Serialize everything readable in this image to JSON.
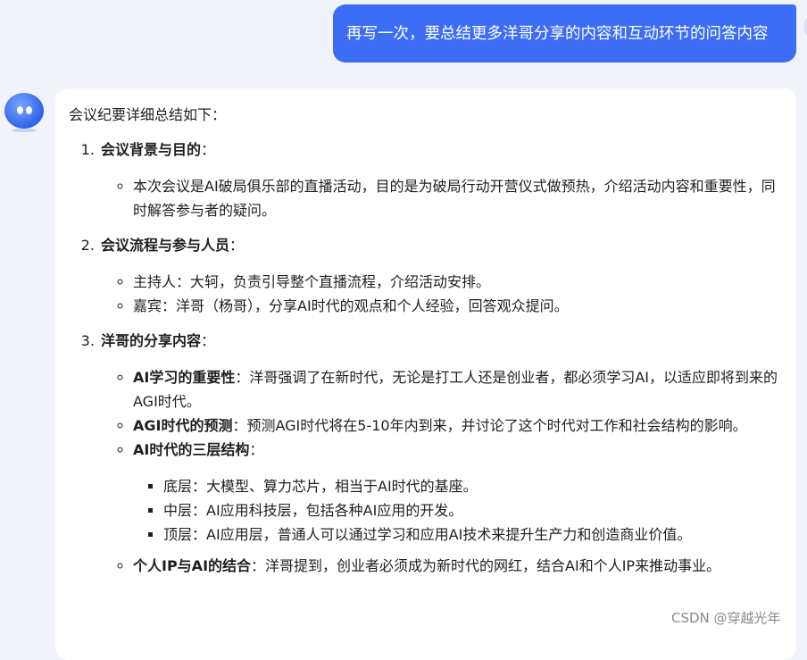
{
  "user_message": "再写一次，要总结更多洋哥分享的内容和互动环节的问答内容",
  "answer": {
    "intro": "会议纪要详细总结如下：",
    "sections": [
      {
        "number": "1.",
        "title": "会议背景与目的",
        "suffix": "：",
        "bullets": [
          {
            "text": "本次会议是AI破局俱乐部的直播活动，目的是为破局行动开营仪式做预热，介绍活动内容和重要性，同时解答参与者的疑问。"
          }
        ]
      },
      {
        "number": "2.",
        "title": "会议流程与参与人员",
        "suffix": "：",
        "bullets": [
          {
            "text": "主持人：大轲，负责引导整个直播流程，介绍活动安排。"
          },
          {
            "text": "嘉宾：洋哥（杨哥），分享AI时代的观点和个人经验，回答观众提问。"
          }
        ]
      },
      {
        "number": "3.",
        "title": "洋哥的分享内容",
        "suffix": "：",
        "bullets": [
          {
            "label": "AI学习的重要性",
            "text": "：洋哥强调了在新时代，无论是打工人还是创业者，都必须学习AI，以适应即将到来的AGI时代。"
          },
          {
            "label": "AGI时代的预测",
            "text": "：预测AGI时代将在5-10年内到来，并讨论了这个时代对工作和社会结构的影响。"
          },
          {
            "label": "AI时代的三层结构",
            "text": "：",
            "sub": [
              "底层：大模型、算力芯片，相当于AI时代的基座。",
              "中层：AI应用科技层，包括各种AI应用的开发。",
              "顶层：AI应用层，普通人可以通过学习和应用AI技术来提升生产力和创造商业价值。"
            ]
          },
          {
            "label": "个人IP与AI的结合",
            "text": "：洋哥提到，创业者必须成为新时代的网红，结合AI和个人IP来推动事业。"
          }
        ]
      }
    ]
  },
  "watermark": "CSDN @穿越光年",
  "colors": {
    "user_bubble": "#3d6df4",
    "background": "#f1f3fa",
    "card": "#ffffff"
  }
}
